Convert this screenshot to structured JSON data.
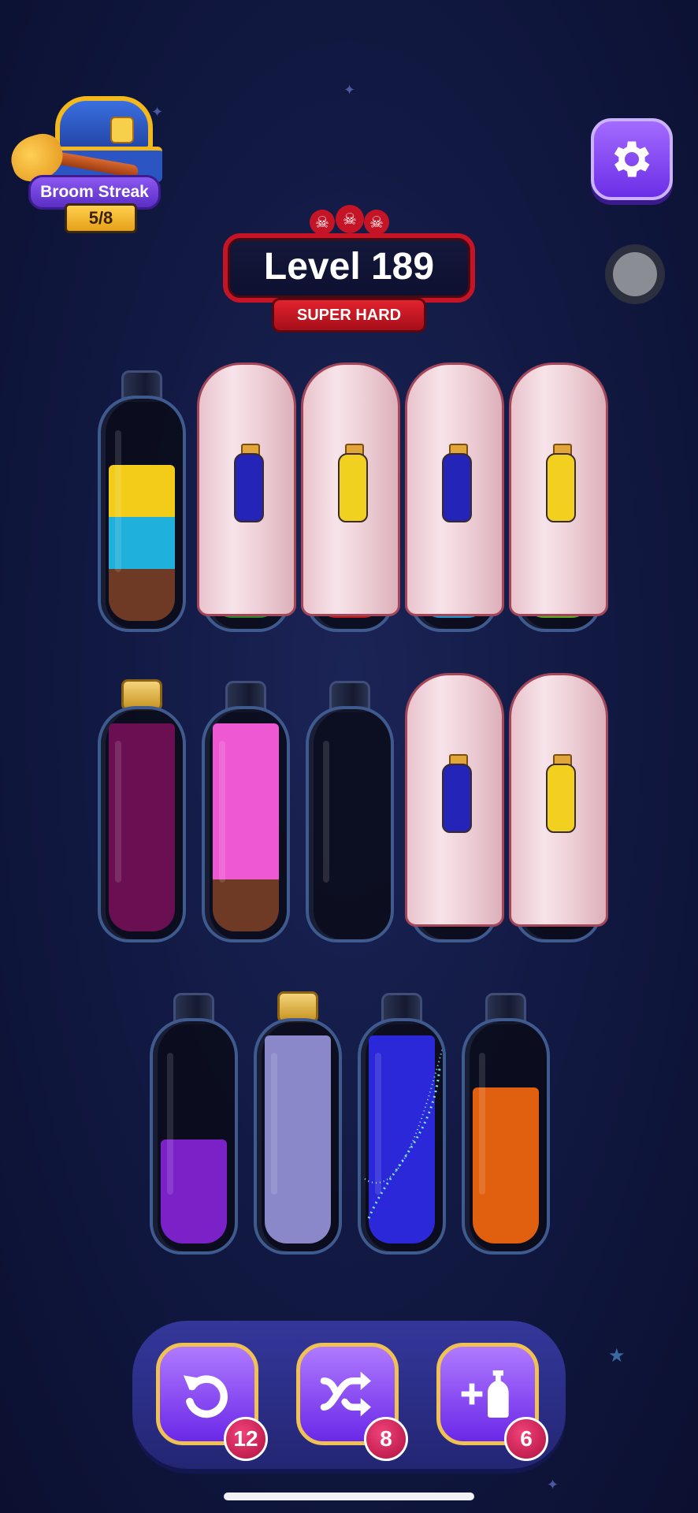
{
  "streak": {
    "label": "Broom Streak",
    "count": "5/8"
  },
  "level": {
    "title": "Level 189",
    "difficulty": "SUPER HARD"
  },
  "bottles": [
    {
      "covered": false,
      "cork": false,
      "layers": [
        "#6e3a26",
        "#1fb0db",
        "#f2cc18"
      ]
    },
    {
      "covered": true,
      "hint_color": "#2424b8",
      "ring_color": "#2a8a2a"
    },
    {
      "covered": true,
      "hint_color": "#f2d020",
      "ring_color": "#c01a1a"
    },
    {
      "covered": true,
      "hint_color": "#2424b8",
      "ring_color": "#1a9ad0"
    },
    {
      "covered": true,
      "hint_color": "#f2d020",
      "ring_color": "#5bb020"
    },
    {
      "covered": false,
      "cork": true,
      "layers": [
        "#6a0f52",
        "#6a0f52",
        "#6a0f52",
        "#6a0f52"
      ]
    },
    {
      "covered": false,
      "cork": false,
      "layers": [
        "#6e3a26",
        "#ee58d2",
        "#ee58d2",
        "#ee58d2"
      ]
    },
    {
      "covered": false,
      "cork": false,
      "layers": []
    },
    {
      "covered": true,
      "hint_color": "#2424b8",
      "ring_color": "#0a0a14"
    },
    {
      "covered": true,
      "hint_color": "#f2d020",
      "ring_color": "#0a0a14"
    },
    {
      "covered": false,
      "cork": false,
      "layers": [
        "#7a22c8",
        "#7a22c8"
      ]
    },
    {
      "covered": false,
      "cork": true,
      "layers": [
        "#8a88c8",
        "#8a88c8",
        "#8a88c8",
        "#8a88c8"
      ]
    },
    {
      "covered": false,
      "cork": false,
      "layers": [
        "#2a28d8",
        "#2a28d8",
        "#2a28d8",
        "#2a28d8"
      ],
      "sparkle": true
    },
    {
      "covered": false,
      "cork": false,
      "layers": [
        "#e06010",
        "#e06010",
        "#e06010"
      ]
    }
  ],
  "tools": [
    {
      "name": "undo",
      "icon": "undo-icon",
      "count": "12"
    },
    {
      "name": "shuffle",
      "icon": "shuffle-icon",
      "count": "8"
    },
    {
      "name": "add-bottle",
      "icon": "add-bottle-icon",
      "count": "6"
    }
  ]
}
